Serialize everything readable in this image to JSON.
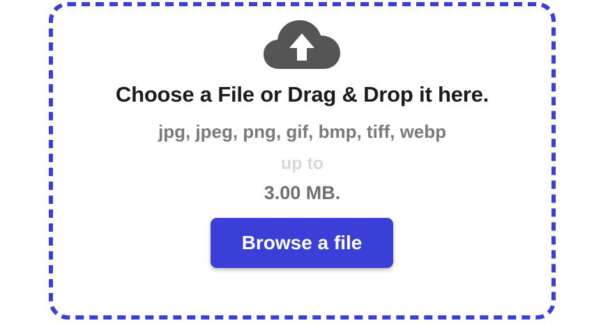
{
  "upload": {
    "title": "Choose a File or Drag & Drop it here.",
    "file_types": "jpg, jpeg, png, gif, bmp, tiff, webp",
    "up_to_label": "up to",
    "max_size": "3.00 MB.",
    "browse_label": "Browse a file",
    "icon": "cloud-upload-icon",
    "colors": {
      "border": "#3a3fd8",
      "button": "#3a3fd8",
      "icon": "#555555"
    }
  }
}
